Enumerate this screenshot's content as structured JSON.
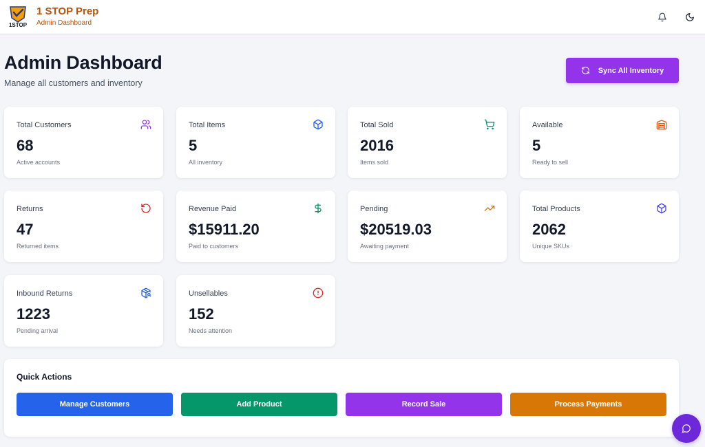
{
  "brand": {
    "name": "1 STOP Prep",
    "subtitle": "Admin Dashboard",
    "logo_text": "1STOP"
  },
  "header": {
    "title": "Admin Dashboard",
    "subtitle": "Manage all customers and inventory",
    "sync_label": "Sync All Inventory"
  },
  "stats": [
    {
      "label": "Total Customers",
      "value": "68",
      "sub": "Active accounts",
      "icon": "users-icon",
      "color": "#9333ea"
    },
    {
      "label": "Total Items",
      "value": "5",
      "sub": "All inventory",
      "icon": "box-icon",
      "color": "#2563eb"
    },
    {
      "label": "Total Sold",
      "value": "2016",
      "sub": "Items sold",
      "icon": "cart-icon",
      "color": "#059669"
    },
    {
      "label": "Available",
      "value": "5",
      "sub": "Ready to sell",
      "icon": "warehouse-icon",
      "color": "#ea580c"
    },
    {
      "label": "Returns",
      "value": "47",
      "sub": "Returned items",
      "icon": "rotate-ccw-icon",
      "color": "#dc2626"
    },
    {
      "label": "Revenue Paid",
      "value": "$15911.20",
      "sub": "Paid to customers",
      "icon": "dollar-icon",
      "color": "#059669"
    },
    {
      "label": "Pending",
      "value": "$20519.03",
      "sub": "Awaiting payment",
      "icon": "trending-up-icon",
      "color": "#d97706"
    },
    {
      "label": "Total Products",
      "value": "2062",
      "sub": "Unique SKUs",
      "icon": "package-icon",
      "color": "#4f46e5"
    },
    {
      "label": "Inbound Returns",
      "value": "1223",
      "sub": "Pending arrival",
      "icon": "package-search-icon",
      "color": "#2563eb"
    },
    {
      "label": "Unsellables",
      "value": "152",
      "sub": "Needs attention",
      "icon": "alert-circle-icon",
      "color": "#dc2626"
    }
  ],
  "quick_actions": {
    "title": "Quick Actions",
    "buttons": [
      {
        "label": "Manage Customers",
        "color": "#2563eb"
      },
      {
        "label": "Add Product",
        "color": "#059669"
      },
      {
        "label": "Record Sale",
        "color": "#9333ea"
      },
      {
        "label": "Process Payments",
        "color": "#d97706"
      }
    ]
  }
}
